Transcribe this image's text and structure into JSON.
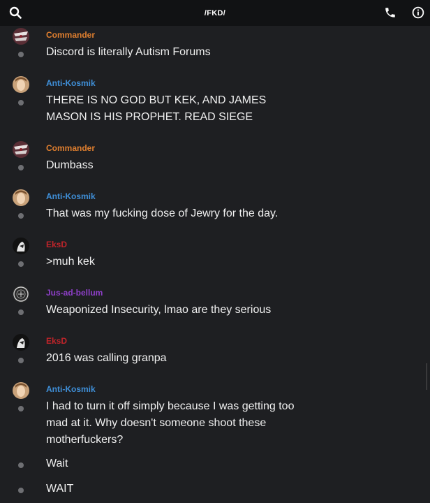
{
  "header": {
    "title": "/FKD/"
  },
  "messages": [
    {
      "author": "Commander",
      "author_color": "#e07f2f",
      "avatar": "commander-avatar",
      "lines": [
        "Discord is literally Autism Forums"
      ]
    },
    {
      "author": "Anti-Kosmik",
      "author_color": "#3f8fd8",
      "avatar": "anti-kosmik-avatar",
      "lines": [
        "THERE IS NO GOD BUT KEK, AND JAMES",
        "MASON IS HIS PROPHET. READ SIEGE"
      ]
    },
    {
      "author": "Commander",
      "author_color": "#e07f2f",
      "avatar": "commander-avatar",
      "lines": [
        "Dumbass"
      ]
    },
    {
      "author": "Anti-Kosmik",
      "author_color": "#3f8fd8",
      "avatar": "anti-kosmik-avatar",
      "lines": [
        "That was my fucking dose of Jewry for the day."
      ]
    },
    {
      "author": "EksD",
      "author_color": "#c0242a",
      "avatar": "eksd-avatar",
      "lines": [
        ">muh kek"
      ]
    },
    {
      "author": "Jus-ad-bellum",
      "author_color": "#8e3fc9",
      "avatar": "jus-ad-bellum-avatar",
      "lines": [
        "Weaponized Insecurity, lmao are they serious"
      ]
    },
    {
      "author": "EksD",
      "author_color": "#c0242a",
      "avatar": "eksd-avatar",
      "lines": [
        "2016 was calling granpa"
      ]
    },
    {
      "author": "Anti-Kosmik",
      "author_color": "#3f8fd8",
      "avatar": "anti-kosmik-avatar",
      "lines": [
        "I had to turn it off simply because I was getting too",
        "mad at it. Why doesn't someone shoot these",
        "motherfuckers?"
      ]
    },
    {
      "author": "",
      "lines": [
        "Wait"
      ]
    },
    {
      "author": "",
      "lines": [
        "WAIT"
      ]
    }
  ]
}
